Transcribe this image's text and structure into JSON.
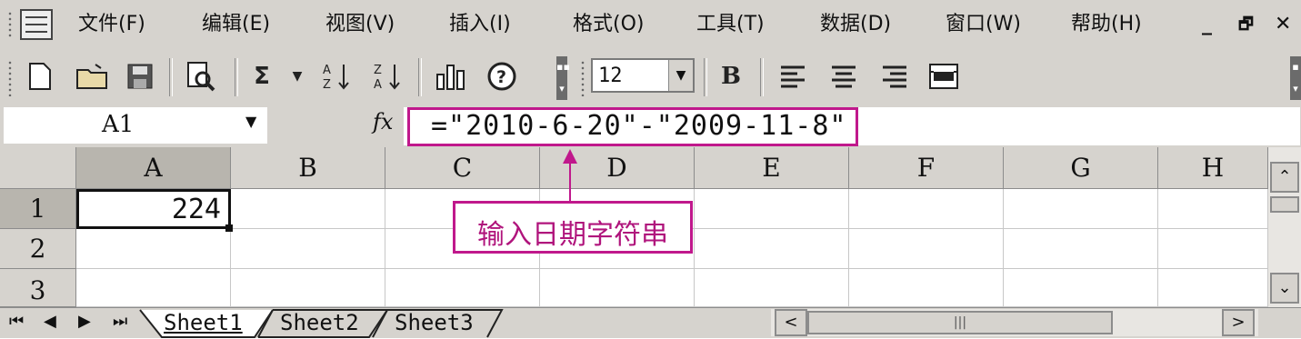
{
  "menu": {
    "items": [
      "文件(F)",
      "编辑(E)",
      "视图(V)",
      "插入(I)",
      "格式(O)",
      "工具(T)",
      "数据(D)",
      "窗口(W)",
      "帮助(H)"
    ],
    "window_controls": [
      "_",
      "🗗",
      "✕"
    ]
  },
  "toolbar": {
    "font_size": "12",
    "sum_symbol": "Σ",
    "bold_label": "B"
  },
  "formula_bar": {
    "name_box": "A1",
    "fx_label": "fx",
    "formula": "=\"2010-6-20\"-\"2009-11-8\""
  },
  "grid": {
    "columns": [
      "A",
      "B",
      "C",
      "D",
      "E",
      "F",
      "G",
      "H"
    ],
    "rows": [
      "1",
      "2",
      "3"
    ],
    "cells": {
      "A1": "224"
    }
  },
  "callout": {
    "text": "输入日期字符串"
  },
  "sheets": {
    "tabs": [
      "Sheet1",
      "Sheet2",
      "Sheet3"
    ],
    "active": "Sheet1"
  },
  "colors": {
    "highlight": "#c0188c",
    "chrome": "#d6d3ce"
  }
}
